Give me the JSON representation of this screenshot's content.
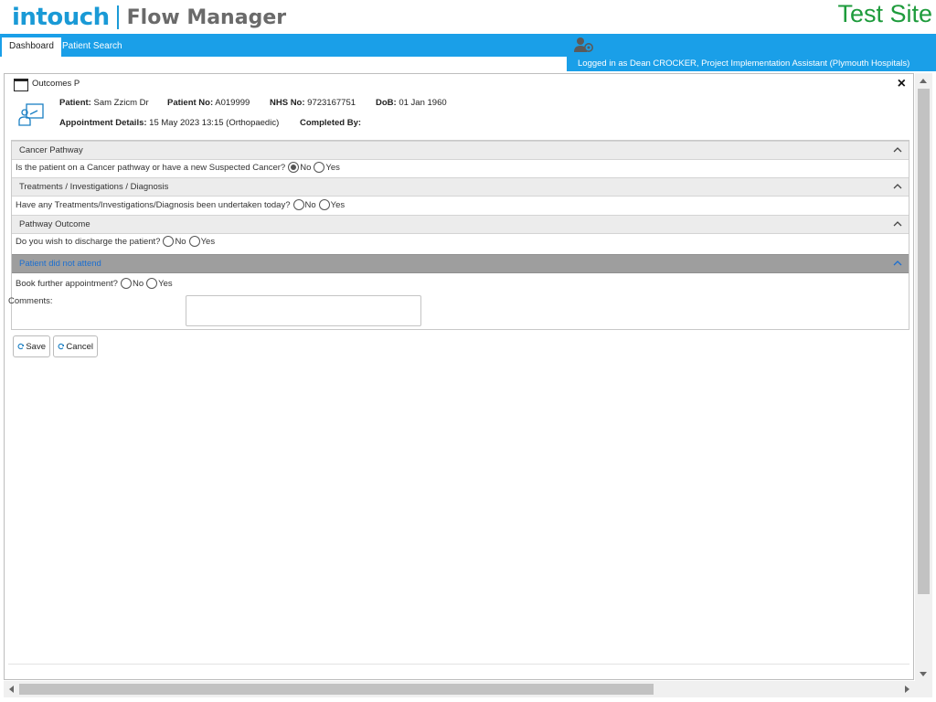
{
  "header": {
    "brand": "intouch",
    "product": "Flow Manager",
    "site_label": "Test Site"
  },
  "nav": {
    "tabs": [
      {
        "label": "Dashboard",
        "active": true
      },
      {
        "label": "Patient Search",
        "active": false
      }
    ],
    "user_icon": "user-settings-icon",
    "logged_in_text": "Logged in as Dean CROCKER, Project Implementation Assistant (Plymouth Hospitals)"
  },
  "dialog": {
    "title": "Outcomes P",
    "close_symbol": "×",
    "patient": {
      "name_label": "Patient:",
      "name_value": "Sam Zzicm Dr",
      "number_label": "Patient No:",
      "number_value": "A019999",
      "nhs_label": "NHS No:",
      "nhs_value": "9723167751",
      "dob_label": "DoB:",
      "dob_value": "01 Jan 1960",
      "appointment_label": "Appointment Details:",
      "appointment_value": "15 May 2023 13:15 (Orthopaedic)",
      "completed_label": "Completed By:",
      "completed_value": ""
    },
    "sections": [
      {
        "title": "Cancer Pathway",
        "question": "Is the patient on a Cancer pathway or have a new Suspected Cancer?",
        "options": [
          "No",
          "Yes"
        ],
        "selected": "No"
      },
      {
        "title": "Treatments / Investigations / Diagnosis",
        "question": "Have any Treatments/Investigations/Diagnosis been undertaken today?",
        "options": [
          "No",
          "Yes"
        ],
        "selected": null
      },
      {
        "title": "Pathway Outcome",
        "question": "Do you wish to discharge the patient?",
        "options": [
          "No",
          "Yes"
        ],
        "selected": null
      },
      {
        "title": "Patient did not attend",
        "question": "Book further appointment?",
        "options": [
          "No",
          "Yes"
        ],
        "selected": null,
        "highlighted": true
      }
    ],
    "comments_label": "Comments:",
    "comments_value": "",
    "buttons": {
      "save": "Save",
      "cancel": "Cancel"
    }
  },
  "colors": {
    "brand_blue": "#1a9ad6",
    "nav_blue": "#1a9fe8",
    "site_green": "#1e9b3c",
    "section_header": "#ececec",
    "section_header_dark": "#9e9e9e",
    "section_link_blue": "#1c6fd0"
  }
}
